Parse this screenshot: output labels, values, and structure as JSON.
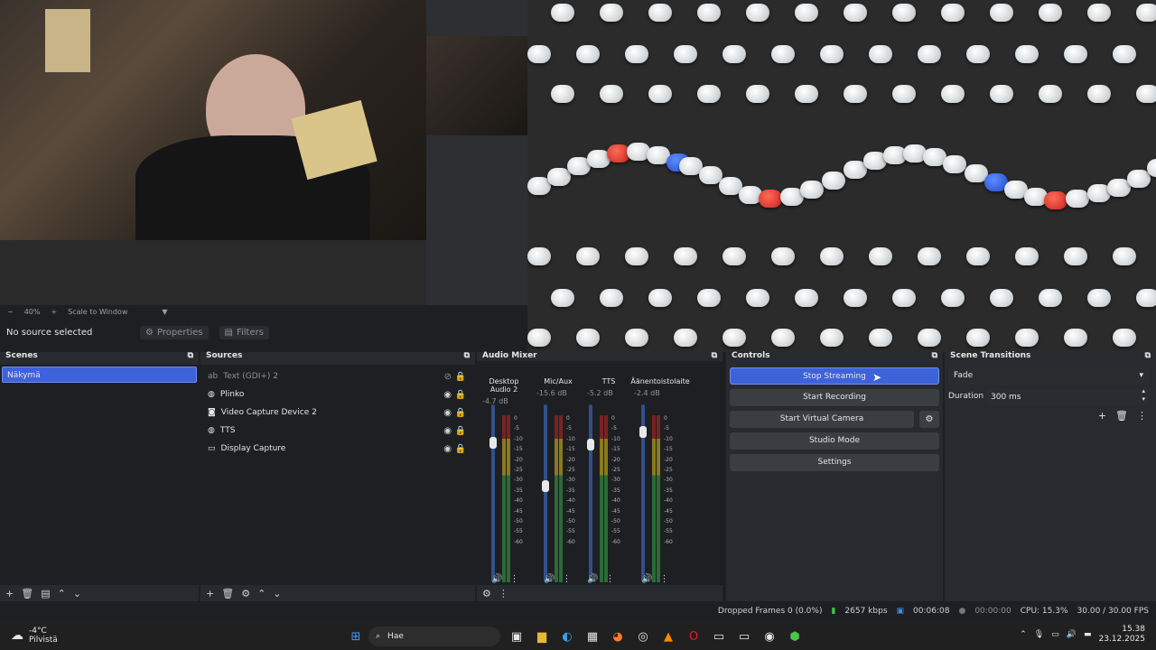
{
  "zoom_bar": {
    "zoom": "40%",
    "scale_mode": "Scale to Window"
  },
  "context_bar": {
    "selection": "No source selected",
    "properties": "Properties",
    "filters": "Filters"
  },
  "scenes": {
    "title": "Scenes",
    "items": [
      {
        "label": "Näkymä",
        "selected": true
      }
    ]
  },
  "sources": {
    "title": "Sources",
    "items": [
      {
        "label": "Text (GDI+) 2",
        "icon": "text-icon",
        "hidden": true
      },
      {
        "label": "Plinko",
        "icon": "browser-icon",
        "hidden": false
      },
      {
        "label": "Video Capture Device 2",
        "icon": "camera-icon",
        "hidden": false
      },
      {
        "label": "TTS",
        "icon": "browser-icon",
        "hidden": false
      },
      {
        "label": "Display Capture",
        "icon": "monitor-icon",
        "hidden": false
      }
    ]
  },
  "mixer": {
    "title": "Audio Mixer",
    "channels": [
      {
        "name": "Desktop Audio 2",
        "db": "-4.7 dB"
      },
      {
        "name": "Mic/Aux",
        "db": "-15.6 dB"
      },
      {
        "name": "TTS",
        "db": "-5.2 dB"
      },
      {
        "name": "Äänentoistolaite",
        "db": "-2.4 dB"
      }
    ],
    "ticks": [
      "0",
      "-5",
      "-10",
      "-15",
      "-20",
      "-25",
      "-30",
      "-35",
      "-40",
      "-45",
      "-50",
      "-55",
      "-60"
    ]
  },
  "controls": {
    "title": "Controls",
    "stop_streaming": "Stop Streaming",
    "start_recording": "Start Recording",
    "start_virtual_camera": "Start Virtual Camera",
    "studio_mode": "Studio Mode",
    "settings": "Settings"
  },
  "transitions": {
    "title": "Scene Transitions",
    "selected": "Fade",
    "duration_label": "Duration",
    "duration_value": "300 ms"
  },
  "status": {
    "dropped_frames": "Dropped Frames 0 (0.0%)",
    "bitrate": "2657 kbps",
    "stream_time": "00:06:08",
    "rec_time": "00:00:00",
    "cpu": "CPU: 15.3%",
    "fps": "30.00 / 30.00 FPS"
  },
  "taskbar": {
    "weather_temp": "-4°C",
    "weather_desc": "Pilvistä",
    "search": "Hae",
    "time": "15.38",
    "date": "23.12.2025"
  }
}
